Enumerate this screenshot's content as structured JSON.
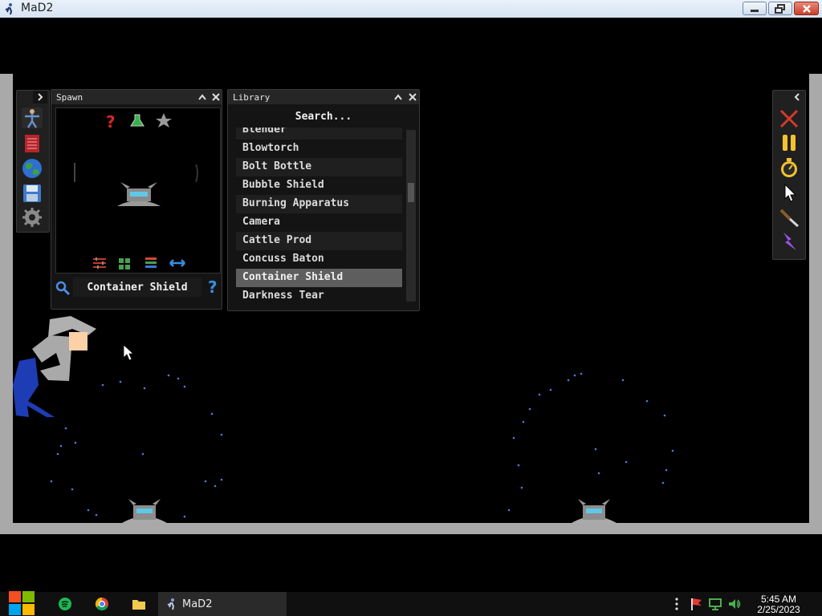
{
  "window": {
    "title": "MaD2"
  },
  "spawn_panel": {
    "title": "Spawn",
    "selected_name": "Container Shield"
  },
  "library_panel": {
    "title": "Library",
    "search_placeholder": "Search...",
    "items": [
      "Blender",
      "Blowtorch",
      "Bolt Bottle",
      "Bubble Shield",
      "Burning Apparatus",
      "Camera",
      "Cattle Prod",
      "Concuss Baton",
      "Container Shield",
      "Darkness Tear"
    ],
    "selected": "Container Shield"
  },
  "left_toolbar": {
    "icons": [
      "humanoid-icon",
      "book-icon",
      "globe-icon",
      "save-disk-icon",
      "gear-icon"
    ]
  },
  "right_toolbar": {
    "icons": [
      "close-x-icon",
      "pause-icon",
      "stopwatch-icon",
      "pointer-icon",
      "knife-icon",
      "lightning-icon"
    ]
  },
  "taskbar": {
    "pinned": [
      "windows-start-icon",
      "spotify-icon",
      "chrome-icon",
      "folder-icon"
    ],
    "active_task": "MaD2",
    "time": "5:45 AM",
    "date": "2/25/2023"
  },
  "colors": {
    "wall": "#a9a9a9",
    "panel_bg": "#141414",
    "selected_row": "#5e5e5e",
    "close_red": "#d43a2a",
    "accent_yellow": "#f2c230",
    "ragdoll_blue": "#1e3cb4"
  }
}
